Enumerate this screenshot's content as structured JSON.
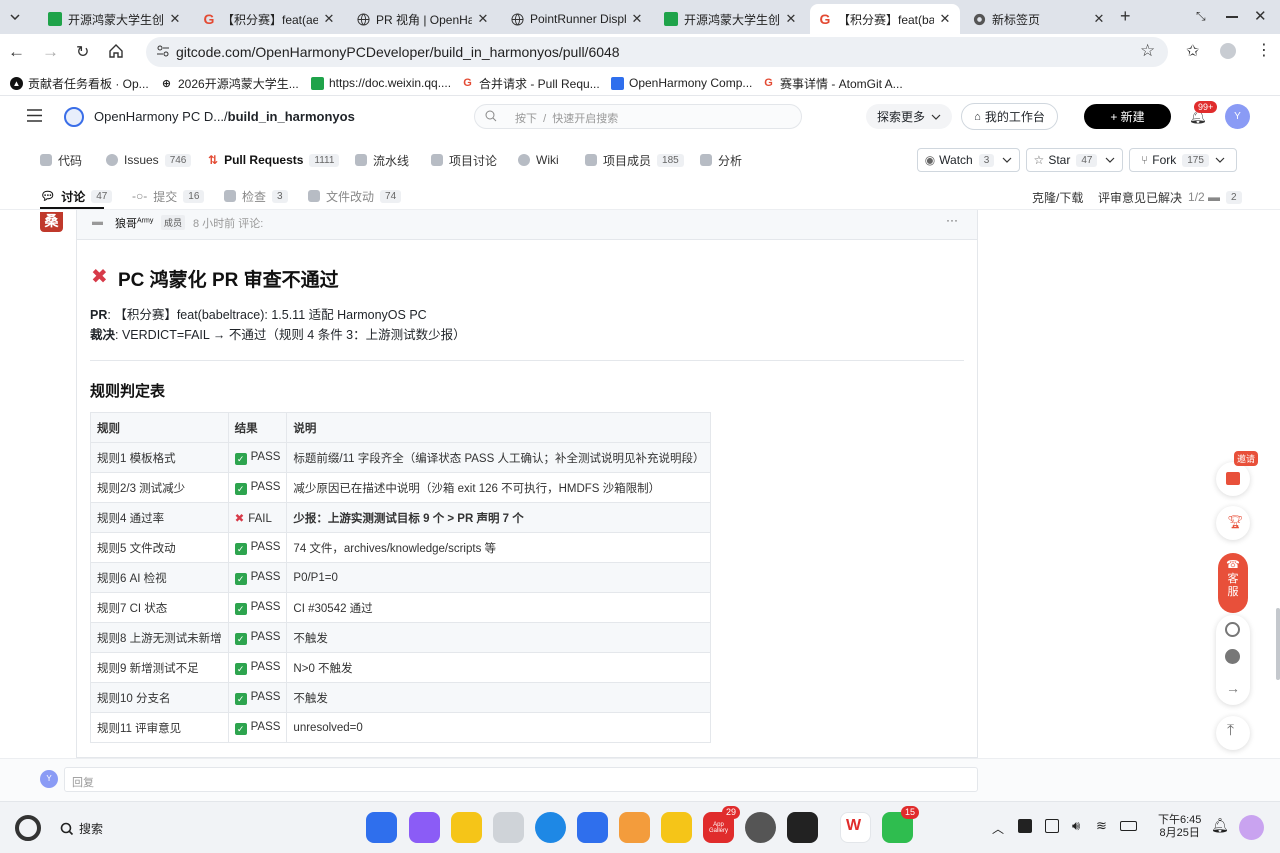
{
  "browser": {
    "tabs": [
      {
        "title": "开源鸿蒙大学生创",
        "icon": "sheet-icon"
      },
      {
        "title": "【积分赛】feat(aet",
        "icon": "gitcode-icon"
      },
      {
        "title": "PR 视角 | OpenHar",
        "icon": "globe-icon"
      },
      {
        "title": "PointRunner Displ",
        "icon": "globe-icon"
      },
      {
        "title": "开源鸿蒙大学生创",
        "icon": "sheet-icon"
      },
      {
        "title": "【积分赛】feat(ba",
        "icon": "gitcode-icon"
      },
      {
        "title": "新标签页",
        "icon": "chrome-icon"
      }
    ],
    "url": "gitcode.com/OpenHarmonyPCDeveloper/build_in_harmonyos/pull/6048",
    "bookmarks": [
      "贡献者任务看板 · Op...",
      "2026开源鸿蒙大学生...",
      "https://doc.weixin.qq....",
      "合并请求 - Pull Requ...",
      "OpenHarmony Comp...",
      "赛事详情 - AtomGit A..."
    ]
  },
  "site": {
    "repo_owner": "OpenHarmony PC D...",
    "repo_sep": "/",
    "repo_name": "build_in_harmonyos",
    "search_placeholder": "按下",
    "search_hint": "快速开启搜索",
    "explore_label": "探索更多",
    "workbench_label": "我的工作台",
    "new_label": "+ 新建",
    "notif_badge": "99+",
    "avatar_letter": "Y"
  },
  "repo_nav": {
    "items": [
      {
        "label": "代码",
        "count": ""
      },
      {
        "label": "Issues",
        "count": "746"
      },
      {
        "label": "Pull Requests",
        "count": "1111"
      },
      {
        "label": "流水线",
        "count": ""
      },
      {
        "label": "项目讨论",
        "count": ""
      },
      {
        "label": "Wiki",
        "count": ""
      },
      {
        "label": "项目成员",
        "count": "185"
      },
      {
        "label": "分析",
        "count": ""
      }
    ],
    "watch": {
      "label": "Watch",
      "count": "3"
    },
    "star": {
      "label": "Star",
      "count": "47"
    },
    "fork": {
      "label": "Fork",
      "count": "175"
    }
  },
  "pr_tabs": {
    "items": [
      {
        "label": "讨论",
        "count": "47"
      },
      {
        "label": "提交",
        "count": "16"
      },
      {
        "label": "检查",
        "count": "3"
      },
      {
        "label": "文件改动",
        "count": "74"
      }
    ],
    "clone_label": "克隆/下载",
    "review_label": "评审意见已解决",
    "review_value": "1/2",
    "comment_count": "2"
  },
  "comment": {
    "author": "狼哥",
    "author_sup": "Army",
    "role_badge": "成员",
    "time": "8 小时前 评论:",
    "title": "PC 鸿蒙化 PR 审查不通过",
    "pr_label": "PR",
    "pr_value": ": 【积分赛】feat(babeltrace): 1.5.11 适配 HarmonyOS PC",
    "verdict_label": "裁决",
    "verdict_value": ": VERDICT=FAIL → 不通过（规则 4 条件 3：上游测试数少报）",
    "section_title": "规则判定表",
    "table": {
      "headers": [
        "规则",
        "结果",
        "说明"
      ],
      "rows": [
        {
          "rule": "规则1 模板格式",
          "result": "PASS",
          "ok": true,
          "desc": "标题前缀/11 字段齐全（编译状态 PASS 人工确认；补全测试说明见补充说明段）",
          "bold": false
        },
        {
          "rule": "规则2/3 测试减少",
          "result": "PASS",
          "ok": true,
          "desc": "减少原因已在描述中说明（沙箱 exit 126 不可执行，HMDFS 沙箱限制）",
          "bold": false
        },
        {
          "rule": "规则4 通过率",
          "result": "FAIL",
          "ok": false,
          "desc": "少报：上游实测测试目标 9 个 > PR 声明 7 个",
          "bold": true
        },
        {
          "rule": "规则5 文件改动",
          "result": "PASS",
          "ok": true,
          "desc": "74 文件，archives/knowledge/scripts 等",
          "bold": false
        },
        {
          "rule": "规则6 AI 检视",
          "result": "PASS",
          "ok": true,
          "desc": "P0/P1=0",
          "bold": false
        },
        {
          "rule": "规则7 CI 状态",
          "result": "PASS",
          "ok": true,
          "desc": "CI #30542 通过",
          "bold": false
        },
        {
          "rule": "规则8 上游无测试未新增",
          "result": "PASS",
          "ok": true,
          "desc": "不触发",
          "bold": false
        },
        {
          "rule": "规则9 新增测试不足",
          "result": "PASS",
          "ok": true,
          "desc": "N>0 不触发",
          "bold": false
        },
        {
          "rule": "规则10 分支名",
          "result": "PASS",
          "ok": true,
          "desc": "不触发",
          "bold": false
        },
        {
          "rule": "规则11 评审意见",
          "result": "PASS",
          "ok": true,
          "desc": "unresolved=0",
          "bold": false
        }
      ]
    }
  },
  "reply": {
    "avatar_letter": "Y",
    "placeholder": "回复"
  },
  "float": {
    "invite_label": "邀请",
    "service_label": "客服"
  },
  "taskbar": {
    "search_label": "搜索",
    "time": "下午6:45",
    "date": "8月25日",
    "appgallery_badge": "29",
    "wechat_badge": "15",
    "appgallery_label": "App Gallery"
  }
}
